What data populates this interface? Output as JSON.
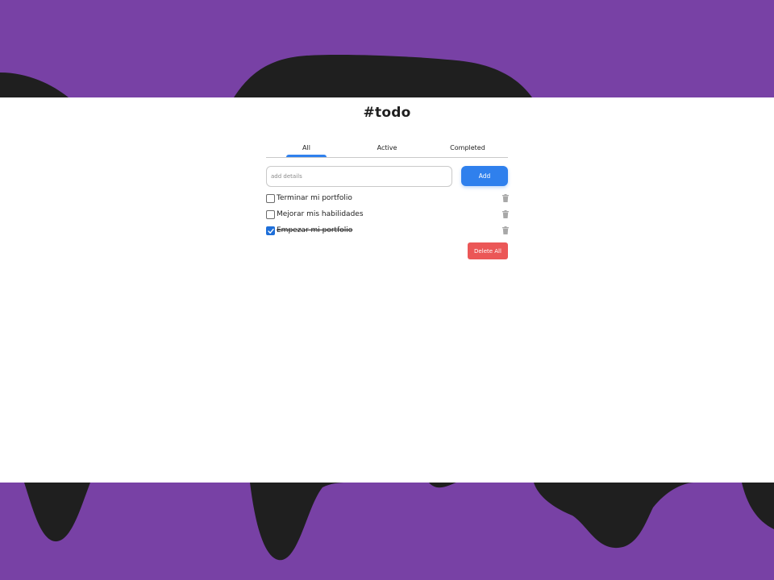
{
  "app": {
    "title": "#todo"
  },
  "tabs": [
    {
      "label": "All",
      "selected": true
    },
    {
      "label": "Active",
      "selected": false
    },
    {
      "label": "Completed",
      "selected": false
    }
  ],
  "new_task": {
    "placeholder": "add details",
    "value": "",
    "add_label": "Add"
  },
  "tasks": [
    {
      "label": "Terminar mi portfolio",
      "completed": false,
      "delete_icon": "trash-icon"
    },
    {
      "label": "Mejorar mis habilidades",
      "completed": false,
      "delete_icon": "trash-icon"
    },
    {
      "label": "Empezar mi portfolio",
      "completed": true,
      "delete_icon": "trash-icon"
    }
  ],
  "footer": {
    "delete_all_label": "Delete All"
  },
  "colors": {
    "background": "#7841a5",
    "blob": "#1f1f1f",
    "accent": "#2f80ed",
    "danger": "#eb5757"
  }
}
